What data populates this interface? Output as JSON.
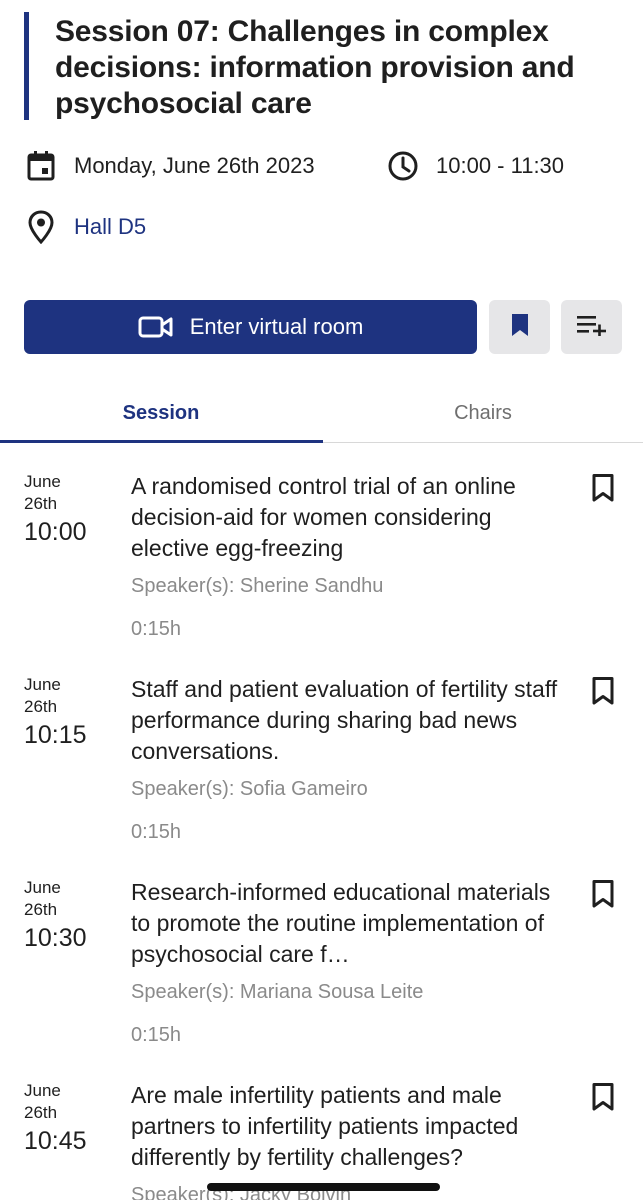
{
  "session": {
    "title": "Session 07: Challenges in complex decisions: information provision and psychosocial care",
    "date": "Monday, June 26th 2023",
    "time": "10:00 - 11:30",
    "location": "Hall D5"
  },
  "actions": {
    "virtual_room_label": "Enter virtual room"
  },
  "tabs": [
    {
      "label": "Session",
      "active": true
    },
    {
      "label": "Chairs",
      "active": false
    }
  ],
  "talks": [
    {
      "month": "June",
      "day": "26th",
      "time": "10:00",
      "title": "A randomised control trial of an online decision-aid for women considering elective egg-freezing",
      "speakers": "Speaker(s): Sherine Sandhu",
      "duration": "0:15h"
    },
    {
      "month": "June",
      "day": "26th",
      "time": "10:15",
      "title": "Staff and patient evaluation of fertility staff performance during sharing bad news conversations.",
      "speakers": "Speaker(s): Sofia Gameiro",
      "duration": "0:15h"
    },
    {
      "month": "June",
      "day": "26th",
      "time": "10:30",
      "title": "Research-informed educational materials to promote the routine implementation of psychosocial care f…",
      "speakers": "Speaker(s): Mariana Sousa Leite",
      "duration": "0:15h"
    },
    {
      "month": "June",
      "day": "26th",
      "time": "10:45",
      "title": "Are male infertility patients and male partners to infertility patients impacted differently by fertility challenges?",
      "speakers": "Speaker(s): Jacky Boivin",
      "duration": ""
    }
  ],
  "colors": {
    "accent": "#1e3380",
    "muted_text": "#8a8a8a",
    "button_bg": "#e6e6e8"
  },
  "icons": {
    "date": "calendar-icon",
    "time": "clock-icon",
    "location": "location-pin-icon",
    "virtual": "video-camera-icon",
    "bookmark_filled": "bookmark-filled-icon",
    "add_to_list": "playlist-add-icon",
    "talk_bookmark": "bookmark-outline-icon"
  }
}
